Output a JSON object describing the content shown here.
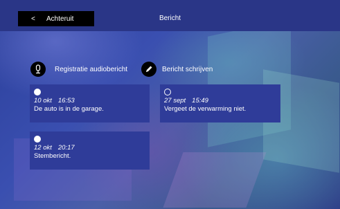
{
  "header": {
    "back_glyph": "<",
    "back_label": "Achteruit",
    "title": "Bericht"
  },
  "actions": [
    {
      "label": "Registratie audiobericht",
      "icon": "microphone-icon"
    },
    {
      "label": "Bericht schrijven",
      "icon": "pencil-icon"
    }
  ],
  "messages": [
    {
      "date": "10 okt",
      "time": "16:53",
      "text": "De auto is in de garage.",
      "status": "filled"
    },
    {
      "date": "27 sept",
      "time": "15:49",
      "text": "Vergeet de verwarming niet.",
      "status": "hollow"
    },
    {
      "date": "12 okt",
      "time": "20:17",
      "text": "Stembericht.",
      "status": "filled"
    }
  ],
  "colors": {
    "header_bar": "#2a3687",
    "card": "#2f3c99",
    "button": "#000000",
    "text": "#ffffff"
  }
}
